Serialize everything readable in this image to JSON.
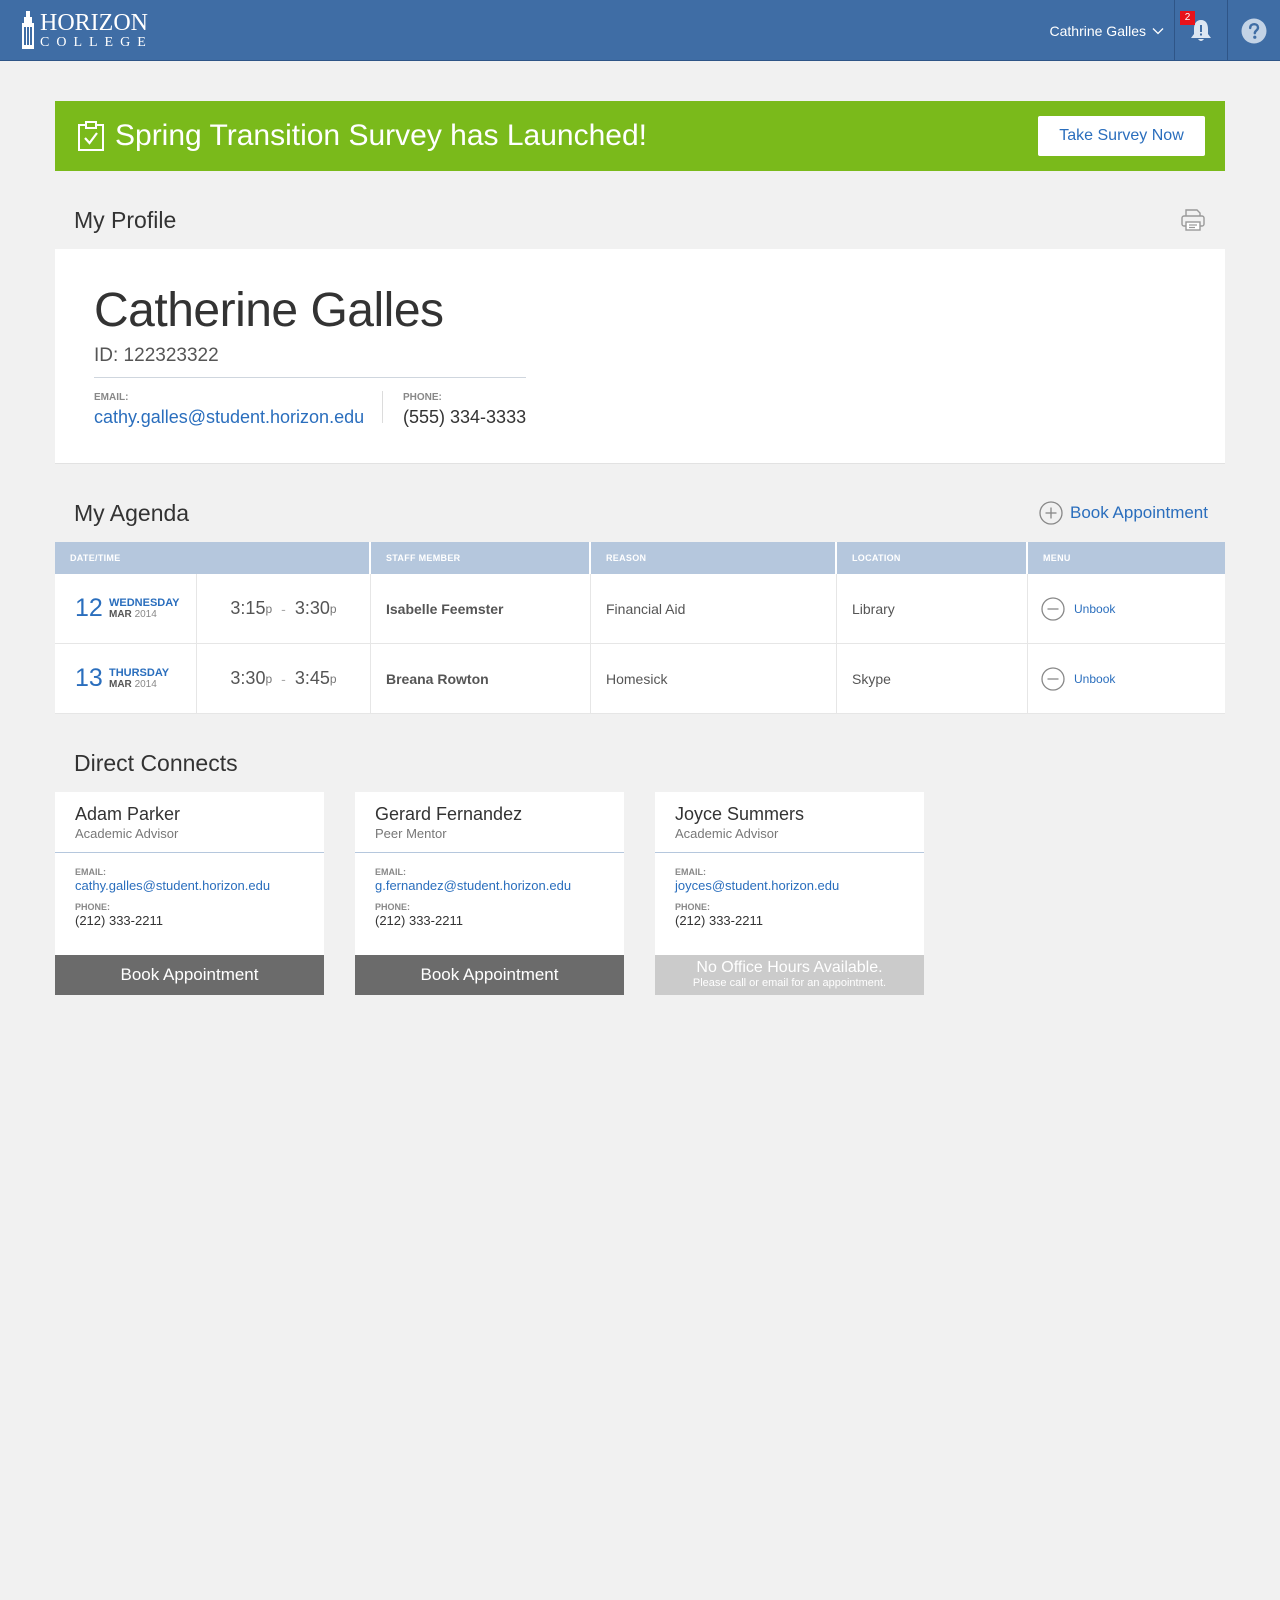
{
  "app": {
    "logo_line1": "HORIZON",
    "logo_line2": "COLLEGE"
  },
  "header": {
    "user_name": "Cathrine Galles",
    "notification_count": "2",
    "icons": [
      "bell-icon",
      "help-icon",
      "chevron-down-icon"
    ]
  },
  "banner": {
    "text": "Spring Transition Survey has Launched!",
    "button_label": "Take Survey Now",
    "icon": "clipboard-check-icon",
    "color": "#7aba1b"
  },
  "profile": {
    "section_title": "My Profile",
    "name": "Catherine Galles",
    "id_text": "ID: 122323322",
    "email_label": "EMAIL:",
    "email": "cathy.galles@student.horizon.edu",
    "phone_label": "PHONE:",
    "phone": "(555) 334-3333",
    "print_icon": "printer-icon"
  },
  "agenda": {
    "section_title": "My Agenda",
    "book_label": "Book Appointment",
    "columns": [
      "DATE/TIME",
      "STAFF MEMBER",
      "REASON",
      "LOCATION",
      "MENU"
    ],
    "rows": [
      {
        "day": "12",
        "weekday": "WEDNESDAY",
        "month": "MAR",
        "year": "2014",
        "start": "3:15",
        "start_sfx": "p",
        "dash": "-",
        "end": "3:30",
        "end_sfx": "p",
        "staff": "Isabelle Feemster",
        "reason": "Financial Aid",
        "location": "Library",
        "action": "Unbook"
      },
      {
        "day": "13",
        "weekday": "THURSDAY",
        "month": "MAR",
        "year": "2014",
        "start": "3:30",
        "start_sfx": "p",
        "dash": "-",
        "end": "3:45",
        "end_sfx": "p",
        "staff": "Breana Rowton",
        "reason": "Homesick",
        "location": "Skype",
        "action": "Unbook"
      }
    ]
  },
  "connects": {
    "section_title": "Direct Connects",
    "email_label": "EMAIL:",
    "phone_label": "PHONE:",
    "cards": [
      {
        "name": "Adam Parker",
        "role": "Academic Advisor",
        "email": "cathy.galles@student.horizon.edu",
        "phone": "(212) 333-2211",
        "button_label": "Book Appointment"
      },
      {
        "name": "Gerard Fernandez",
        "role": "Peer Mentor",
        "email": "g.fernandez@student.horizon.edu",
        "phone": "(212) 333-2211",
        "button_label": "Book Appointment"
      },
      {
        "name": "Joyce Summers",
        "role": "Academic Advisor",
        "email": "joyces@student.horizon.edu",
        "phone": "(212) 333-2211",
        "unavailable_title": "No Office Hours Available.",
        "unavailable_sub": "Please call or email for an appointment."
      }
    ]
  }
}
